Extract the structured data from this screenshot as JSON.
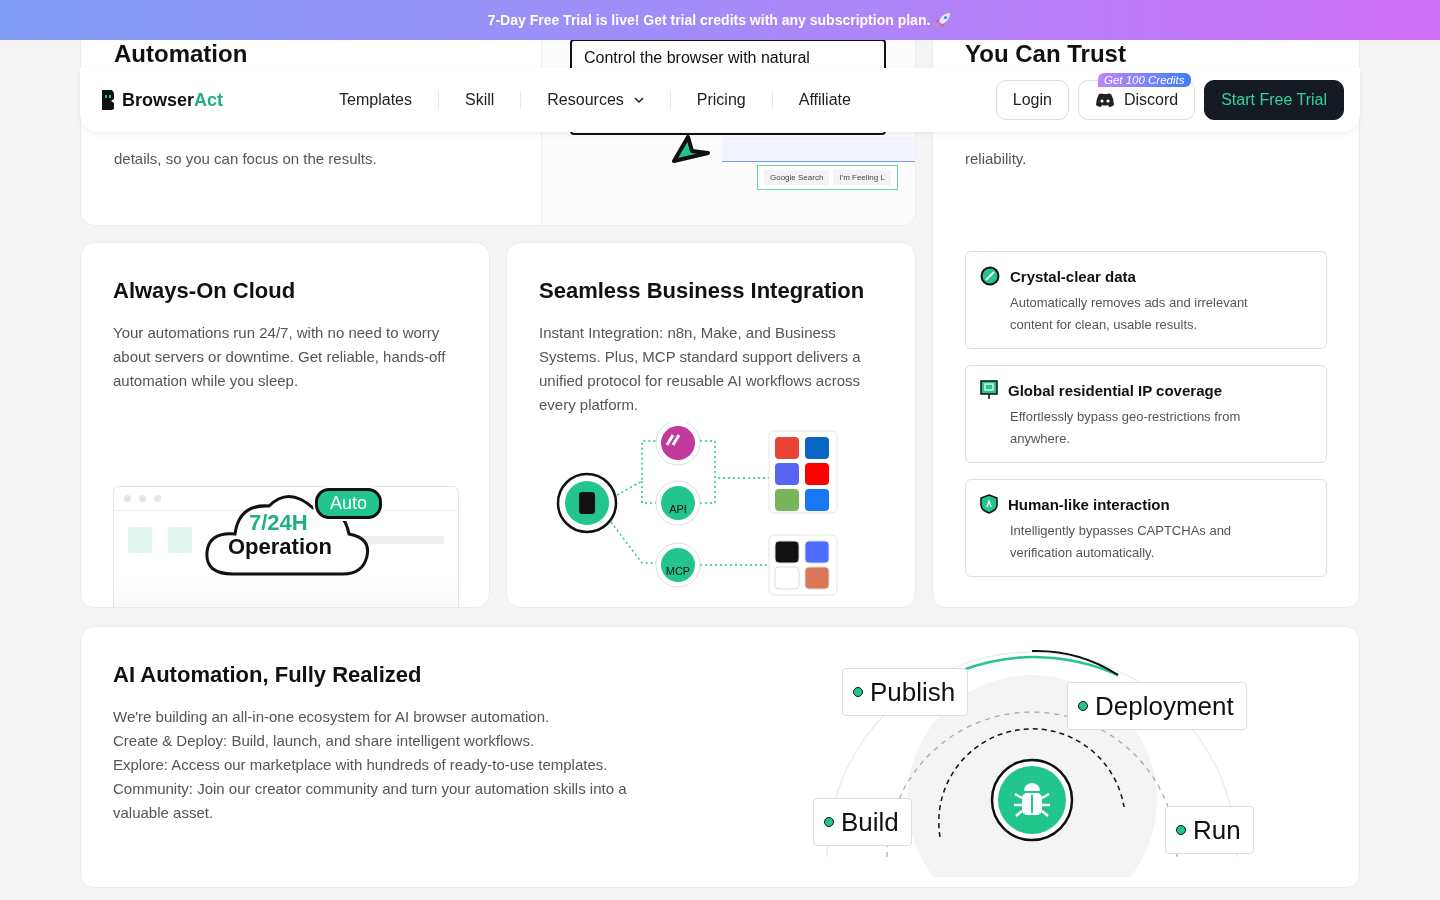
{
  "banner": {
    "text": "7-Day Free Trial is live! Get trial credits with any subscription plan."
  },
  "nav": {
    "brand": {
      "prefix": "Browser",
      "accent": "Act"
    },
    "links": [
      {
        "label": "Templates",
        "dropdown": false
      },
      {
        "label": "Skill",
        "dropdown": false
      },
      {
        "label": "Resources",
        "dropdown": true
      },
      {
        "label": "Pricing",
        "dropdown": false
      },
      {
        "label": "Affiliate",
        "dropdown": false
      }
    ],
    "login": "Login",
    "discord": {
      "label": "Discord",
      "badge": "Get 100 Credits"
    },
    "cta": "Start Free Trial"
  },
  "automation": {
    "heading": "Automation",
    "text": "details, so you can focus on the results.",
    "mockup": {
      "prompt": "Control the browser with natural",
      "buttons": [
        "Google Search",
        "I'm Feeling L"
      ]
    }
  },
  "trust": {
    "heading": "You Can Trust",
    "text": "reliability.",
    "items": [
      {
        "kind": "data",
        "title": "Crystal-clear data",
        "text": "Automatically removes ads and irrelevant content for clean, usable results."
      },
      {
        "kind": "ip",
        "title": "Global residential IP coverage",
        "text": "Effortlessly bypass geo-restrictions from anywhere."
      },
      {
        "kind": "human",
        "title": "Human-like interaction",
        "text": "Intelligently bypasses CAPTCHAs and verification automatically."
      }
    ]
  },
  "cards": [
    {
      "kind": "cloud",
      "title": "Always-On Cloud",
      "text": "Your automations run 24/7, with no need to worry about servers or downtime. Get reliable, hands-off automation while you sleep.",
      "art": {
        "top": "7/24H",
        "bottom": "Operation",
        "badge": "Auto"
      }
    },
    {
      "kind": "integration",
      "title": "Seamless Business Integration",
      "text": "Instant Integration: n8n, Make, and Business Systems. Plus, MCP standard support delivers a unified protocol for reusable AI workflows across every platform.",
      "art": {
        "nodes": [
          "API",
          "MCP"
        ]
      }
    }
  ],
  "ecosystem": {
    "title": "AI Automation, Fully Realized",
    "lines": [
      "We're building an all-in-one ecosystem for AI browser automation.",
      "Create & Deploy: Build, launch, and share intelligent workflows.",
      "Explore: Access our marketplace with hundreds of ready-to-use templates.",
      "Community: Join our creator community and turn your automation skills into a valuable asset."
    ],
    "stages": [
      {
        "label": "Publish"
      },
      {
        "label": "Deployment"
      },
      {
        "label": "Build"
      },
      {
        "label": "Run"
      }
    ]
  }
}
